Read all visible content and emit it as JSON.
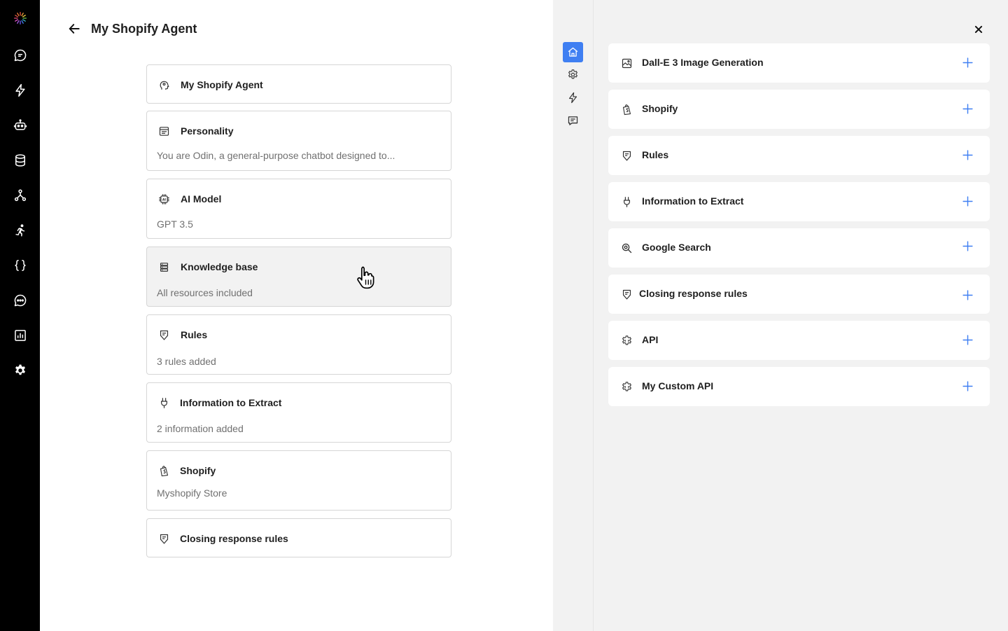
{
  "app": {
    "title": "My Shopify Agent"
  },
  "rail": {
    "items": [
      {
        "icon": "logo-icon"
      },
      {
        "icon": "chat-bubble-icon"
      },
      {
        "icon": "lightning-icon"
      },
      {
        "icon": "robot-icon"
      },
      {
        "icon": "database-icon"
      },
      {
        "icon": "network-icon"
      },
      {
        "icon": "runner-icon"
      },
      {
        "icon": "code-braces-icon"
      },
      {
        "icon": "message-dots-icon"
      },
      {
        "icon": "chart-icon"
      },
      {
        "icon": "settings-gear-icon"
      }
    ]
  },
  "cards": [
    {
      "title": "My Shopify Agent",
      "subtitle": "",
      "icon": "agent-head-icon"
    },
    {
      "title": "Personality",
      "subtitle": "You are Odin, a general-purpose chatbot designed to...",
      "icon": "document-lines-icon"
    },
    {
      "title": "AI Model",
      "subtitle": "GPT 3.5",
      "icon": "chip-ai-icon"
    },
    {
      "title": "Knowledge base",
      "subtitle": "All resources included",
      "icon": "stack-icon"
    },
    {
      "title": "Rules",
      "subtitle": "3 rules added",
      "icon": "rules-icon"
    },
    {
      "title": "Information to Extract",
      "subtitle": "2 information added",
      "icon": "extract-icon"
    },
    {
      "title": "Shopify",
      "subtitle": "Myshopify Store",
      "icon": "shopify-bag-icon"
    },
    {
      "title": "Closing response rules",
      "subtitle": "",
      "icon": "rules-icon"
    }
  ],
  "nav": {
    "items": [
      {
        "icon": "home-icon",
        "active": true
      },
      {
        "icon": "gear-icon",
        "active": false
      },
      {
        "icon": "lightning-icon",
        "active": false
      },
      {
        "icon": "comment-icon",
        "active": false
      }
    ]
  },
  "tools": [
    {
      "label": "Dall-E 3 Image Generation",
      "icon": "image-icon"
    },
    {
      "label": "Shopify",
      "icon": "shopify-bag-icon"
    },
    {
      "label": "Rules",
      "icon": "rules-icon"
    },
    {
      "label": "Information to Extract",
      "icon": "extract-icon"
    },
    {
      "label": "Google Search",
      "icon": "search-icon"
    },
    {
      "label": "Closing response rules",
      "icon": "rules-icon"
    },
    {
      "label": "API",
      "icon": "api-gear-icon"
    },
    {
      "label": "My Custom API",
      "icon": "api-gear-icon"
    }
  ],
  "colors": {
    "accent": "#3f7ff2",
    "rail": "#000000",
    "panel": "#f2f2f2"
  }
}
